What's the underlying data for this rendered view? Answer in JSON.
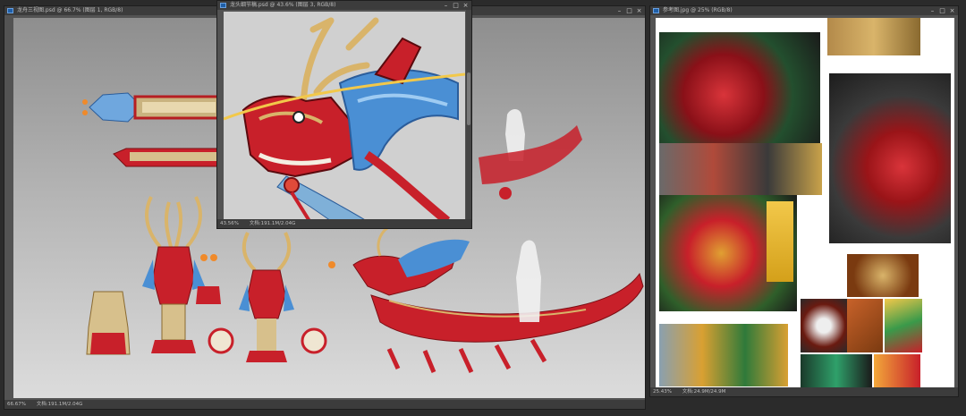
{
  "windows": {
    "left": {
      "title": "龙舟三视图.psd @ 66.7% (图层 1, RGB/8)",
      "zoom": "66.67%",
      "doc": "文档:191.1M/2.04G"
    },
    "middle": {
      "title": "龙头细节稿.psd @ 43.6% (图层 3, RGB/8)",
      "zoom": "43.56%",
      "doc": "文档:191.1M/2.04G"
    },
    "right": {
      "title": "参考图.jpg @ 25% (RGB/8)",
      "zoom": "25.43%",
      "doc": "文档:24.9M/24.9M"
    }
  },
  "icons": [
    "photoshop-doc-icon",
    "minimize-icon",
    "maximize-icon",
    "close-icon"
  ],
  "colors": {
    "app_bg": "#2b2b2b",
    "titlebar": "#3c3c3c",
    "dragon_red": "#c8202a",
    "dragon_blue": "#4a8fd4",
    "dragon_gold": "#d9b46a"
  }
}
